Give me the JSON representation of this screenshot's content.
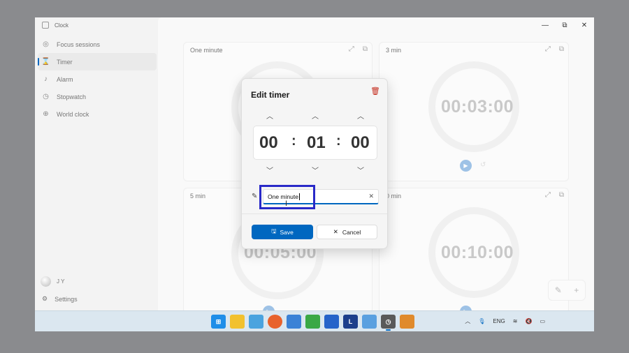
{
  "app": {
    "title": "Clock"
  },
  "sidebar": {
    "items": [
      {
        "label": "Focus sessions",
        "icon": "focus-icon"
      },
      {
        "label": "Timer",
        "icon": "hourglass-icon",
        "active": true
      },
      {
        "label": "Alarm",
        "icon": "bell-icon"
      },
      {
        "label": "Stopwatch",
        "icon": "stopwatch-icon"
      },
      {
        "label": "World clock",
        "icon": "globe-icon"
      }
    ],
    "user": "J Y",
    "settings": "Settings"
  },
  "window_controls": {
    "minimize": "—",
    "restore": "⧉",
    "close": "✕"
  },
  "timers": [
    {
      "title": "One minute",
      "time": ""
    },
    {
      "title": "3 min",
      "time": "00:03:00"
    },
    {
      "title": "5 min",
      "time": "00:05:00"
    },
    {
      "title": "0 min",
      "time": "00:10:00"
    }
  ],
  "dialog": {
    "title": "Edit timer",
    "hours": "00",
    "minutes": "01",
    "seconds": "00",
    "separator": ":",
    "name_value": "One minute",
    "save_label": "Save",
    "cancel_label": "Cancel"
  },
  "taskbar": {
    "language": "ENG",
    "apps": [
      "windows-start-icon",
      "file-explorer-icon",
      "photos-icon",
      "firefox-icon",
      "notepad-icon",
      "spreadsheet-icon",
      "store-icon",
      "l-app-icon",
      "arrow-app-icon",
      "clock-app-icon",
      "snip-icon"
    ]
  },
  "colors": {
    "accent": "#0067c0",
    "highlight": "#2929c8",
    "delete": "#c42b1c"
  }
}
